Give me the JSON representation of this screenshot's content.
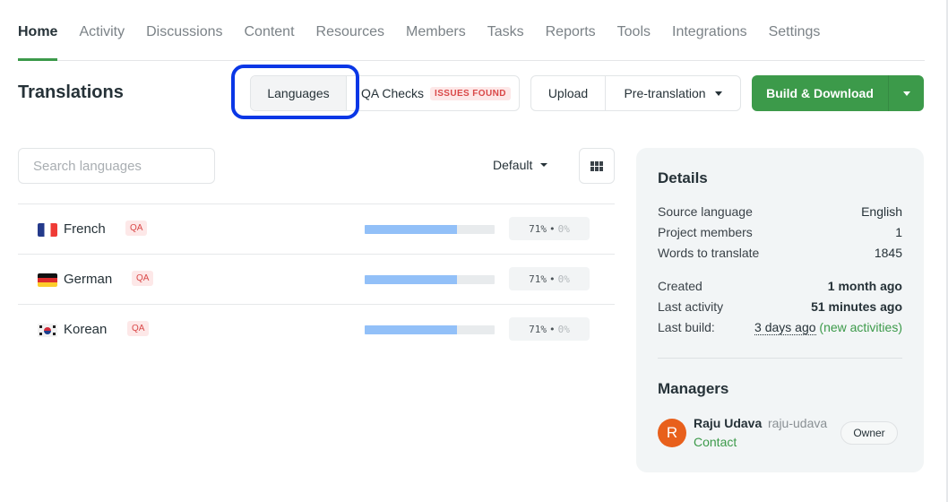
{
  "nav": {
    "tabs": [
      {
        "label": "Home",
        "active": true
      },
      {
        "label": "Activity",
        "active": false
      },
      {
        "label": "Discussions",
        "active": false
      },
      {
        "label": "Content",
        "active": false
      },
      {
        "label": "Resources",
        "active": false
      },
      {
        "label": "Members",
        "active": false
      },
      {
        "label": "Tasks",
        "active": false
      },
      {
        "label": "Reports",
        "active": false
      },
      {
        "label": "Tools",
        "active": false
      },
      {
        "label": "Integrations",
        "active": false
      },
      {
        "label": "Settings",
        "active": false
      }
    ]
  },
  "header": {
    "title": "Translations",
    "view_toggle": {
      "languages_label": "Languages",
      "qa_checks_label": "QA Checks",
      "qa_badge": "ISSUES FOUND",
      "selected": "Languages"
    },
    "upload_label": "Upload",
    "pretranslation_label": "Pre-translation",
    "build_label": "Build & Download"
  },
  "toolbar": {
    "search_placeholder": "Search languages",
    "search_value": "",
    "sort_selected": "Default"
  },
  "languages": [
    {
      "name": "French",
      "flag": "flag-fr",
      "qa_badge": "QA",
      "translated_pct": 71,
      "approved_pct": 0,
      "translated_label": "71%",
      "approved_label": "0%"
    },
    {
      "name": "German",
      "flag": "flag-de",
      "qa_badge": "QA",
      "translated_pct": 71,
      "approved_pct": 0,
      "translated_label": "71%",
      "approved_label": "0%"
    },
    {
      "name": "Korean",
      "flag": "flag-kr",
      "qa_badge": "QA",
      "translated_pct": 71,
      "approved_pct": 0,
      "translated_label": "71%",
      "approved_label": "0%"
    }
  ],
  "details": {
    "title": "Details",
    "rows": [
      {
        "label": "Source language",
        "value": "English"
      },
      {
        "label": "Project members",
        "value": "1"
      },
      {
        "label": "Words to translate",
        "value": "1845"
      }
    ],
    "created_label": "Created",
    "created_value": "1 month ago",
    "last_activity_label": "Last activity",
    "last_activity_value": "51 minutes ago",
    "last_build_label": "Last build:",
    "last_build_value": "3 days ago",
    "last_build_note": "(new activities)"
  },
  "managers": {
    "title": "Managers",
    "items": [
      {
        "initial": "R",
        "name": "Raju Udava",
        "username": "raju-udava",
        "contact_label": "Contact",
        "role": "Owner"
      }
    ]
  },
  "colors": {
    "accent_green": "#3c9a4a",
    "progress_blue": "#92c0f8",
    "issues_red": "#d94848",
    "highlight_blue": "#0a37e6",
    "avatar_orange": "#e8601c"
  }
}
